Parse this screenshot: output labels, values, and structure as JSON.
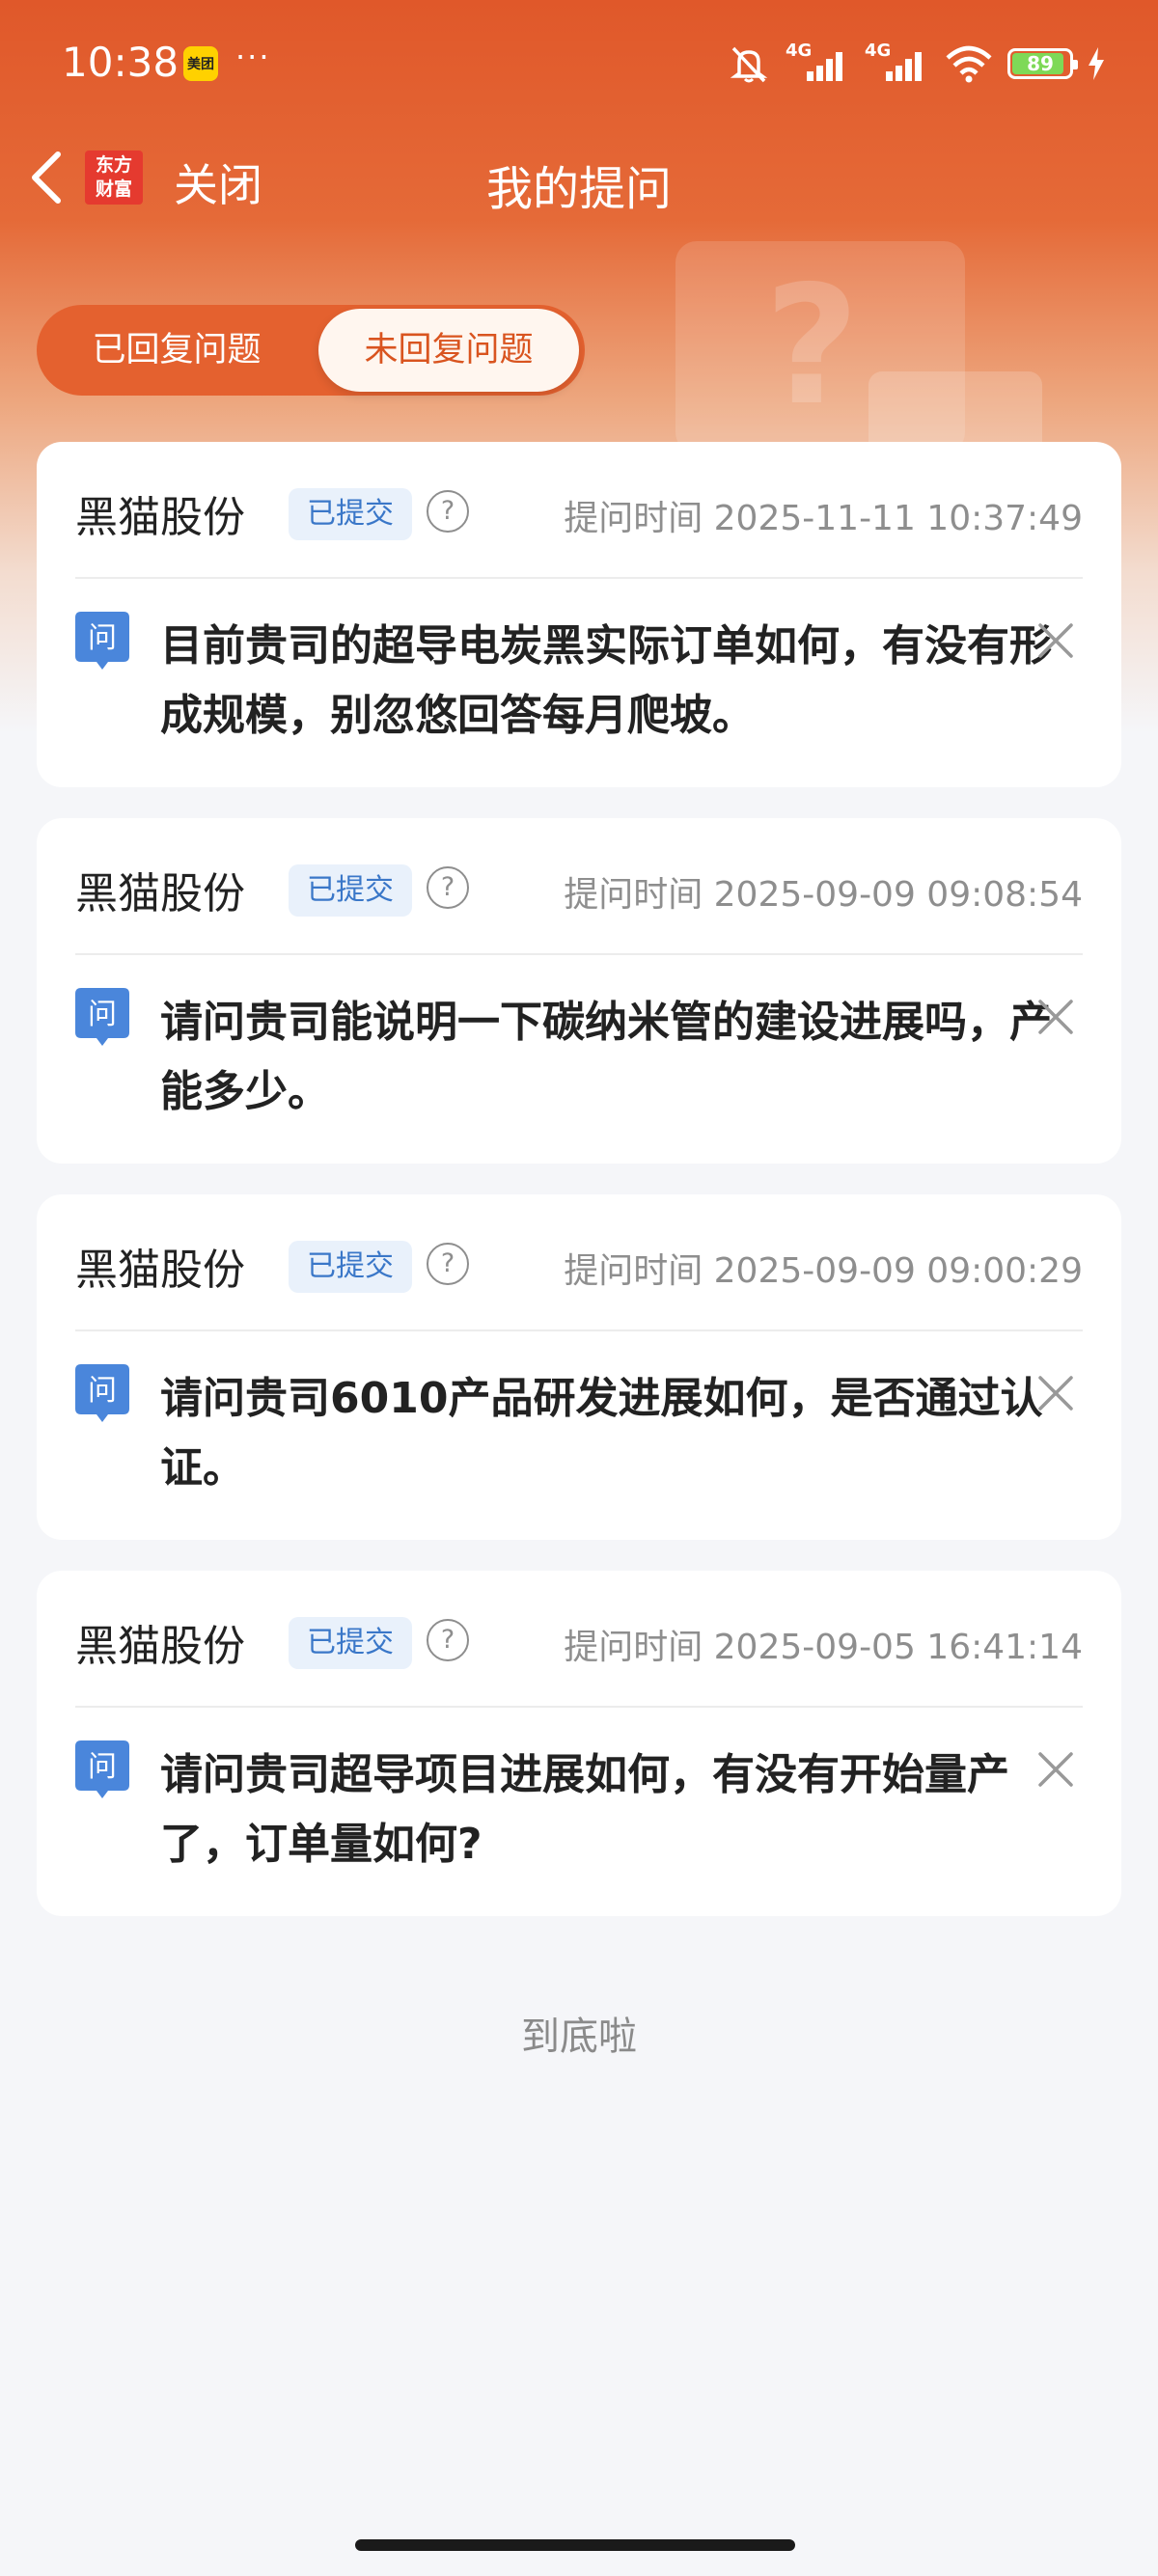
{
  "status_bar": {
    "time": "10:38",
    "app_badge": "美团",
    "more": "···",
    "network_1": "4G",
    "network_2": "4G",
    "battery": "89"
  },
  "nav": {
    "logo_line1": "东方",
    "logo_line2": "财富",
    "close_label": "关闭",
    "title": "我的提问"
  },
  "tabs": {
    "replied": "已回复问题",
    "unreplied": "未回复问题",
    "active": "unreplied"
  },
  "questions": [
    {
      "company": "黑猫股份",
      "status": "已提交",
      "time_label": "提问时间 2025-11-11 10:37:49",
      "text": "目前贵司的超导电炭黑实际订单如何，有没有形成规模，别忽悠回答每月爬坡。"
    },
    {
      "company": "黑猫股份",
      "status": "已提交",
      "time_label": "提问时间 2025-09-09 09:08:54",
      "text": "请问贵司能说明一下碳纳米管的建设进展吗，产能多少。"
    },
    {
      "company": "黑猫股份",
      "status": "已提交",
      "time_label": "提问时间 2025-09-09 09:00:29",
      "text": "请问贵司6010产品研发进展如何，是否通过认证。"
    },
    {
      "company": "黑猫股份",
      "status": "已提交",
      "time_label": "提问时间 2025-09-05 16:41:14",
      "text": "请问贵司超导项目进展如何，有没有开始量产了，订单量如何?"
    }
  ],
  "qa_icon_char": "问",
  "help_char": "?",
  "end_text": "到底啦",
  "colors": {
    "brand": "#e0582a",
    "badge_text": "#3a77c8",
    "badge_bg": "#e9f1fb",
    "qa_icon": "#4a86db"
  }
}
